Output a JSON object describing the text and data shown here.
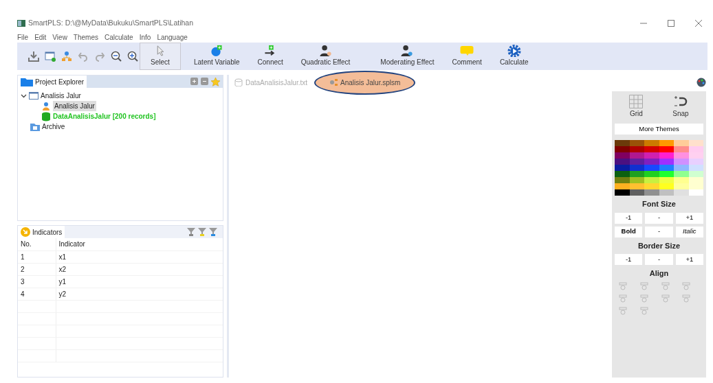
{
  "window": {
    "title": "SmartPLS: D:\\@MyData\\Bukuku\\SmartPLS\\Latihan"
  },
  "menu": [
    "File",
    "Edit",
    "View",
    "Themes",
    "Calculate",
    "Info",
    "Language"
  ],
  "tools": [
    {
      "label": "Select",
      "selected": true,
      "kind": "select"
    },
    {
      "label": "Latent Variable",
      "selected": false,
      "kind": "latent"
    },
    {
      "label": "Connect",
      "selected": false,
      "kind": "connect"
    },
    {
      "label": "Quadratic Effect",
      "selected": false,
      "kind": "quadratic"
    },
    {
      "label": "Moderating Effect",
      "selected": false,
      "kind": "moderating"
    },
    {
      "label": "Comment",
      "selected": false,
      "kind": "comment"
    },
    {
      "label": "Calculate",
      "selected": false,
      "kind": "calculate"
    }
  ],
  "project_explorer": {
    "title": "Project Explorer",
    "tree": [
      {
        "label": "Analisis Jalur",
        "kind": "project",
        "expanded": true,
        "selected": false,
        "children": [
          {
            "label": "Analisis Jalur",
            "kind": "model",
            "selected": true
          },
          {
            "label": "DataAnalisisJalur [200 records]",
            "kind": "data",
            "selected": false
          }
        ]
      },
      {
        "label": "Archive",
        "kind": "archive",
        "selected": false
      }
    ]
  },
  "indicators": {
    "title": "Indicators",
    "columns": [
      "No.",
      "Indicator"
    ],
    "rows": [
      [
        "1",
        "x1"
      ],
      [
        "2",
        "x2"
      ],
      [
        "3",
        "y1"
      ],
      [
        "4",
        "y2"
      ]
    ]
  },
  "editor_tabs": [
    {
      "label": "DataAnalisisJalur.txt",
      "kind": "data",
      "selected": false
    },
    {
      "label": "Analisis Jalur.splsm",
      "kind": "model",
      "selected": true
    }
  ],
  "theme_panel": {
    "grid": "Grid",
    "snap": "Snap",
    "more_themes": "More Themes",
    "swatches": [
      {
        "color": "#6b3a0a"
      },
      {
        "color": "#9a5208"
      },
      {
        "color": "#cc7a00"
      },
      {
        "color": "#ff9900"
      },
      {
        "color": "#ffcc99"
      },
      {
        "color": "#ffe0cc"
      },
      {
        "color": "#800000"
      },
      {
        "color": "#b00000"
      },
      {
        "color": "#d40000"
      },
      {
        "color": "#ff0000"
      },
      {
        "color": "#ff8c8c"
      },
      {
        "color": "#ffccf0"
      },
      {
        "color": "#800060"
      },
      {
        "color": "#b01890"
      },
      {
        "color": "#d020b0"
      },
      {
        "color": "#ff20d0"
      },
      {
        "color": "#ff90e0"
      },
      {
        "color": "#ffd0f0"
      },
      {
        "color": "#4b1080"
      },
      {
        "color": "#6020a0"
      },
      {
        "color": "#8020c0"
      },
      {
        "color": "#a030ff"
      },
      {
        "color": "#d090ff"
      },
      {
        "color": "#e8d0ff"
      },
      {
        "color": "#0a1ca0"
      },
      {
        "color": "#1030d0"
      },
      {
        "color": "#1848ff"
      },
      {
        "color": "#2080ff"
      },
      {
        "color": "#90b8ff"
      },
      {
        "color": "#d0e0ff"
      },
      {
        "color": "#0a6010"
      },
      {
        "color": "#20a020"
      },
      {
        "color": "#20d020"
      },
      {
        "color": "#20ff30"
      },
      {
        "color": "#90ff90"
      },
      {
        "color": "#d0ffd0"
      },
      {
        "color": "#708010"
      },
      {
        "color": "#a0c020"
      },
      {
        "color": "#c8f040"
      },
      {
        "color": "#f0ff40"
      },
      {
        "color": "#ffff90"
      },
      {
        "color": "#ffffd0"
      },
      {
        "color": "#ffb020"
      },
      {
        "color": "#ffc030"
      },
      {
        "color": "#ffd830"
      },
      {
        "color": "#ffff20"
      },
      {
        "color": "#ffffa0"
      },
      {
        "color": "#ffffd0"
      },
      {
        "color": "#000000"
      },
      {
        "color": "#606060"
      },
      {
        "color": "#909090"
      },
      {
        "color": "#c0c0c0"
      },
      {
        "color": "#e0e0e0"
      },
      {
        "color": "#ffffff"
      }
    ],
    "font_size": {
      "title": "Font Size",
      "buttons": [
        "-1",
        "-",
        "+1"
      ]
    },
    "style_buttons": [
      {
        "label": "Bold",
        "kind": "bold"
      },
      {
        "label": "-",
        "kind": "plain"
      },
      {
        "label": "Italic",
        "kind": "italic"
      }
    ],
    "border_size": {
      "title": "Border Size",
      "buttons": [
        "-1",
        "-",
        "+1"
      ]
    },
    "align": {
      "title": "Align"
    }
  }
}
